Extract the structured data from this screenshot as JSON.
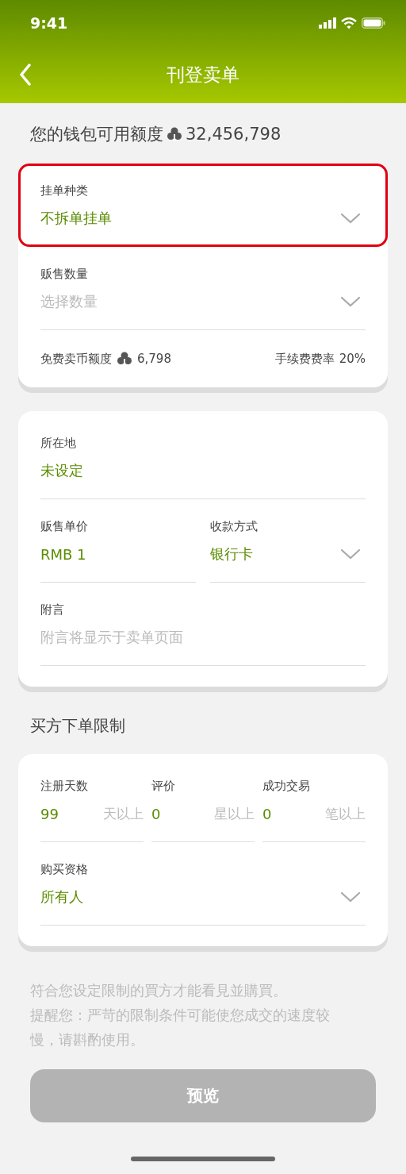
{
  "status_bar": {
    "time": "9:41"
  },
  "nav": {
    "title": "刊登卖单"
  },
  "wallet": {
    "label": "您的钱包可用额度",
    "amount": "32,456,798"
  },
  "order_card": {
    "fields": [
      {
        "label": "挂单种类",
        "value": "不拆单挂单",
        "dropdown": true,
        "highlighted": true
      },
      {
        "label": "贩售数量",
        "placeholder": "选择数量",
        "dropdown": true,
        "highlighted": false
      }
    ],
    "free_quota": {
      "label": "免费卖币额度",
      "amount": "6,798"
    },
    "fee": {
      "label": "手续费费率",
      "value": "20%"
    }
  },
  "detail_card": {
    "rows": [
      [
        {
          "label": "所在地",
          "value": "未设定",
          "dropdown": false
        }
      ],
      [
        {
          "label": "贩售单价",
          "value": "RMB 1",
          "dropdown": false
        },
        {
          "label": "收款方式",
          "value": "银行卡",
          "dropdown": true
        }
      ],
      [
        {
          "label": "附言",
          "placeholder": "附言将显示于卖单页面",
          "dropdown": false
        }
      ]
    ]
  },
  "restrictions": {
    "title": "买方下单限制",
    "limits": [
      {
        "label": "注册天数",
        "value": "99",
        "unit": "天以上"
      },
      {
        "label": "评价",
        "value": "0",
        "unit": "星以上"
      },
      {
        "label": "成功交易",
        "value": "0",
        "unit": "笔以上"
      }
    ],
    "qualification": {
      "label": "购买资格",
      "value": "所有人",
      "dropdown": true
    }
  },
  "notes": [
    "符合您设定限制的買方才能看見並購買。",
    "提醒您：严苛的限制条件可能使您成交的速度较慢，请斟酌使用。"
  ],
  "preview_button": {
    "label": "预览",
    "disabled": true
  }
}
